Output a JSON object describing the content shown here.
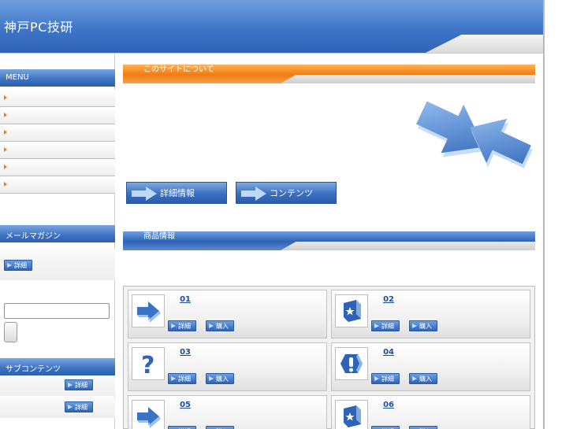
{
  "header": {
    "site_title": "神戸PC技研"
  },
  "sidebar": {
    "menu_title": "MENU",
    "menu_items": [
      "",
      "",
      "",
      "",
      "",
      ""
    ],
    "mail_title": "メールマガジン",
    "mail_detail_label": "詳細",
    "mail_input_value": "",
    "sub_title": "サブコンテンツ",
    "sub_items": [
      {
        "label": "詳細"
      },
      {
        "label": "詳細"
      }
    ]
  },
  "main": {
    "about_title": "このサイトについて",
    "buttons": {
      "details": "詳細情報",
      "contents": "コンテンツ"
    },
    "products_title": "商品情報",
    "products": [
      {
        "num": "01",
        "icon": "arrow-icon",
        "detail": "詳細",
        "buy": "購入"
      },
      {
        "num": "02",
        "icon": "star-box-icon",
        "detail": "詳細",
        "buy": "購入"
      },
      {
        "num": "03",
        "icon": "question-icon",
        "detail": "詳細",
        "buy": "購入"
      },
      {
        "num": "04",
        "icon": "exclamation-icon",
        "detail": "詳細",
        "buy": "購入"
      },
      {
        "num": "05",
        "icon": "arrow-icon",
        "detail": "詳細",
        "buy": "購入"
      },
      {
        "num": "06",
        "icon": "star-box-icon",
        "detail": "詳細",
        "buy": "購入"
      }
    ]
  },
  "colors": {
    "brand_blue": "#3f76c8",
    "accent_orange": "#f07c10"
  }
}
